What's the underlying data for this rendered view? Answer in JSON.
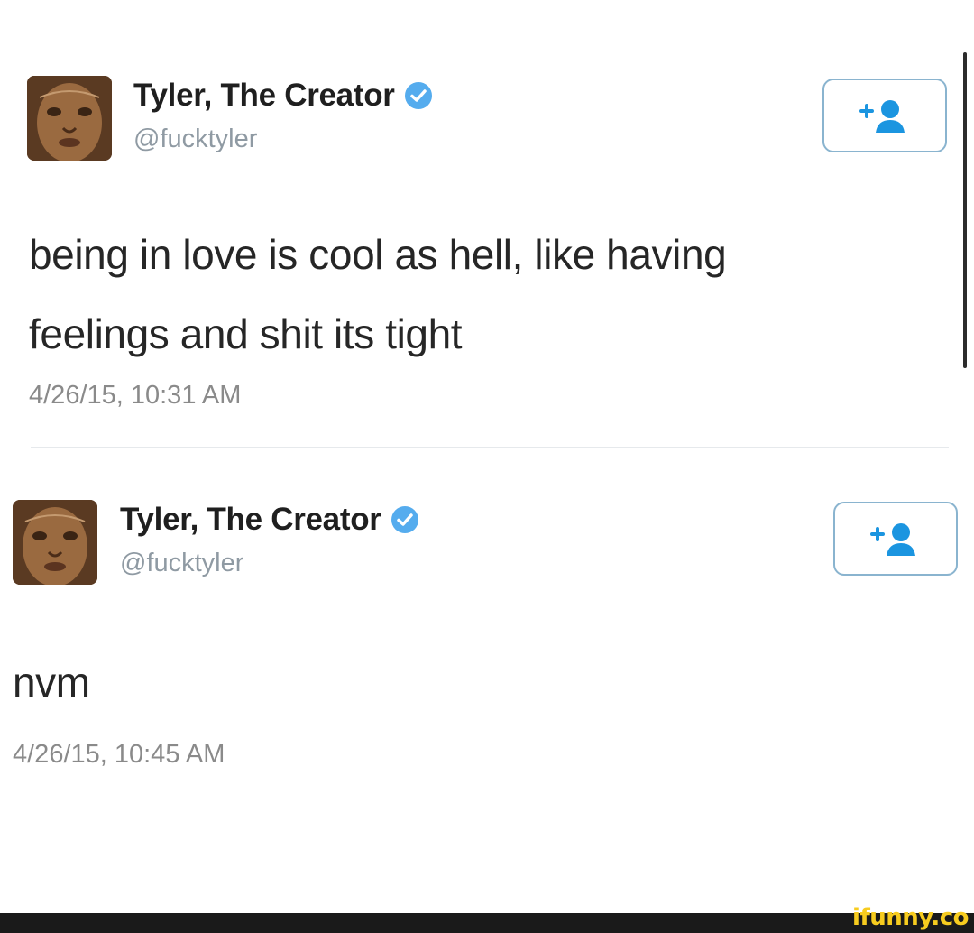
{
  "tweets": [
    {
      "display_name": "Tyler, The Creator",
      "handle": "@fucktyler",
      "text_lines": [
        "being in love is cool as hell, like having",
        "feelings and shit its tight"
      ],
      "timestamp": "4/26/15, 10:31 AM",
      "verified_icon": "verified-badge-icon",
      "follow_icon": "add-user-icon"
    },
    {
      "display_name": "Tyler, The Creator",
      "handle": "@fucktyler",
      "text_lines": [
        "nvm"
      ],
      "timestamp": "4/26/15, 10:45 AM",
      "verified_icon": "verified-badge-icon",
      "follow_icon": "add-user-icon"
    }
  ],
  "watermark": "ifunny.co",
  "colors": {
    "verified_blue": "#55acee",
    "follow_border": "#8ab4cf",
    "follow_icon": "#1b95e0",
    "handle_gray": "#8f9aa3",
    "timestamp_gray": "#8a8a8a",
    "watermark_yellow": "#f7cc1f"
  }
}
